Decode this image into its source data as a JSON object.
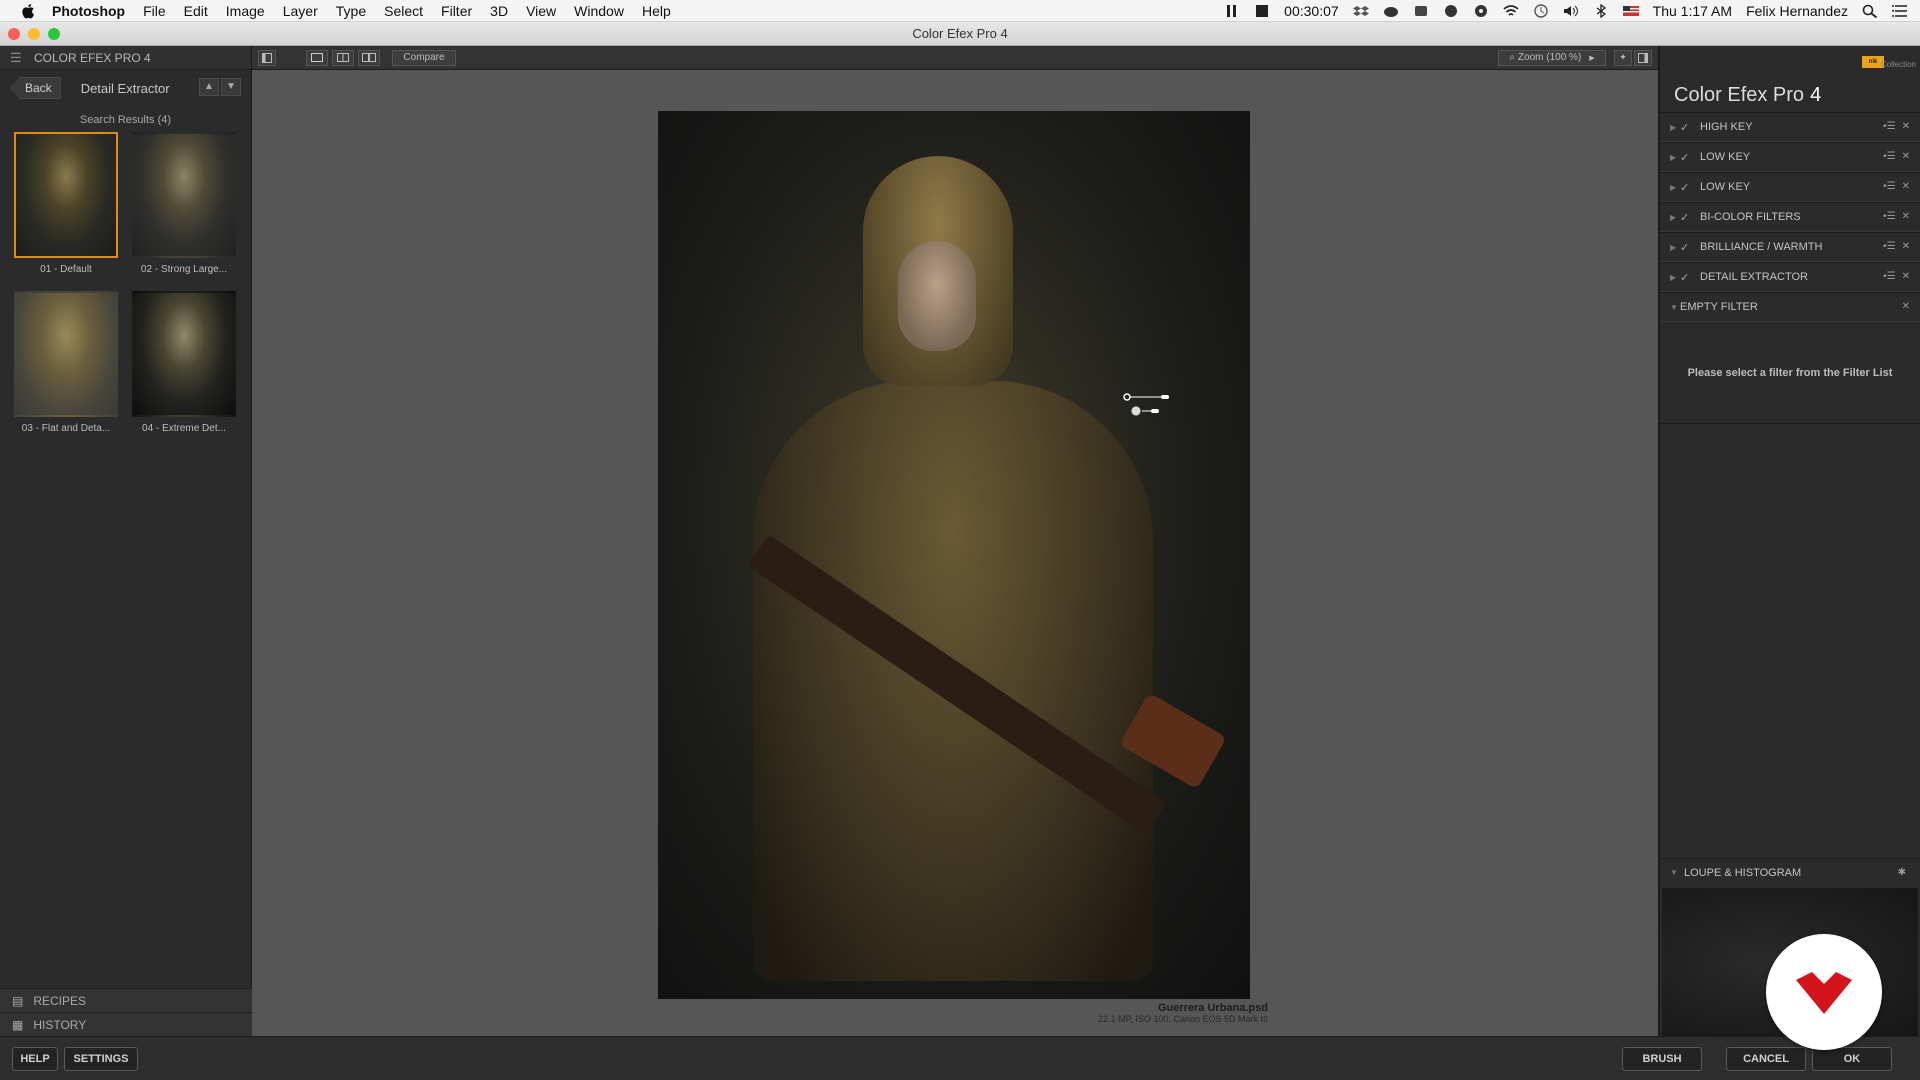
{
  "menubar": {
    "app": "Photoshop",
    "items": [
      "File",
      "Edit",
      "Image",
      "Layer",
      "Type",
      "Select",
      "Filter",
      "3D",
      "View",
      "Window",
      "Help"
    ],
    "timer": "00:30:07",
    "clock": "Thu 1:17 AM",
    "user": "Felix Hernandez"
  },
  "window": {
    "title": "Color Efex Pro 4"
  },
  "left_panel": {
    "header": "COLOR EFEX PRO 4",
    "back_label": "Back",
    "breadcrumb": "Detail Extractor",
    "search_results": "Search Results (4)",
    "presets": [
      {
        "label": "01 - Default",
        "selected": true
      },
      {
        "label": "02 - Strong Large...",
        "selected": false
      },
      {
        "label": "03 - Flat and Deta...",
        "selected": false
      },
      {
        "label": "04 - Extreme Det...",
        "selected": false
      }
    ],
    "recipes": "RECIPES",
    "history": "HISTORY"
  },
  "toolbar": {
    "compare": "Compare",
    "zoom": "Zoom (100 %)"
  },
  "image": {
    "filename": "Guerrera Urbana.psd",
    "info": "22.1 MP, ISO 100, Canon EOS 5D Mark III"
  },
  "right_panel": {
    "collection": "Collection",
    "product": "Color Efex Pro",
    "version": "4",
    "filters": [
      {
        "name": "HIGH KEY"
      },
      {
        "name": "LOW KEY"
      },
      {
        "name": "LOW KEY"
      },
      {
        "name": "BI-COLOR FILTERS"
      },
      {
        "name": "BRILLIANCE / WARMTH"
      },
      {
        "name": "DETAIL EXTRACTOR"
      }
    ],
    "empty_filter": "EMPTY FILTER",
    "empty_message": "Please select a filter from the Filter List",
    "loupe": "LOUPE & HISTOGRAM"
  },
  "bottom": {
    "help": "HELP",
    "settings": "SETTINGS",
    "brush": "BRUSH",
    "cancel": "CANCEL",
    "ok": "OK"
  },
  "colors": {
    "accent": "#e08a1e",
    "brand_red": "#d4141c"
  }
}
